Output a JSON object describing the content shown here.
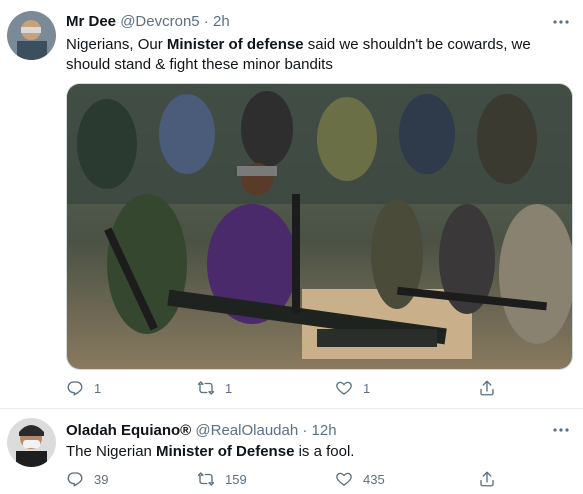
{
  "tweets": [
    {
      "display_name": "Mr Dee",
      "handle": "@Devcron5",
      "separator": "·",
      "time": "2h",
      "text_parts": [
        {
          "text": "Nigerians, Our ",
          "bold": false
        },
        {
          "text": "Minister of defense",
          "bold": true
        },
        {
          "text": " said we shouldn't be cowards, we should stand & fight these minor bandits",
          "bold": false
        }
      ],
      "replies": "1",
      "retweets": "1",
      "likes": "1"
    },
    {
      "display_name": "Oladah Equiano®",
      "handle": "@RealOlaudah",
      "separator": "·",
      "time": "12h",
      "text_parts": [
        {
          "text": "The Nigerian ",
          "bold": false
        },
        {
          "text": "Minister of Defense",
          "bold": true
        },
        {
          "text": " is a fool.",
          "bold": false
        }
      ],
      "replies": "39",
      "retweets": "159",
      "likes": "435"
    }
  ],
  "icons": {
    "reply": "reply-icon",
    "retweet": "retweet-icon",
    "like": "heart-icon",
    "share": "share-icon",
    "more": "more-options-icon"
  },
  "colors": {
    "text": "#0f1419",
    "muted": "#5b7083",
    "divider": "#e6ecf0"
  }
}
